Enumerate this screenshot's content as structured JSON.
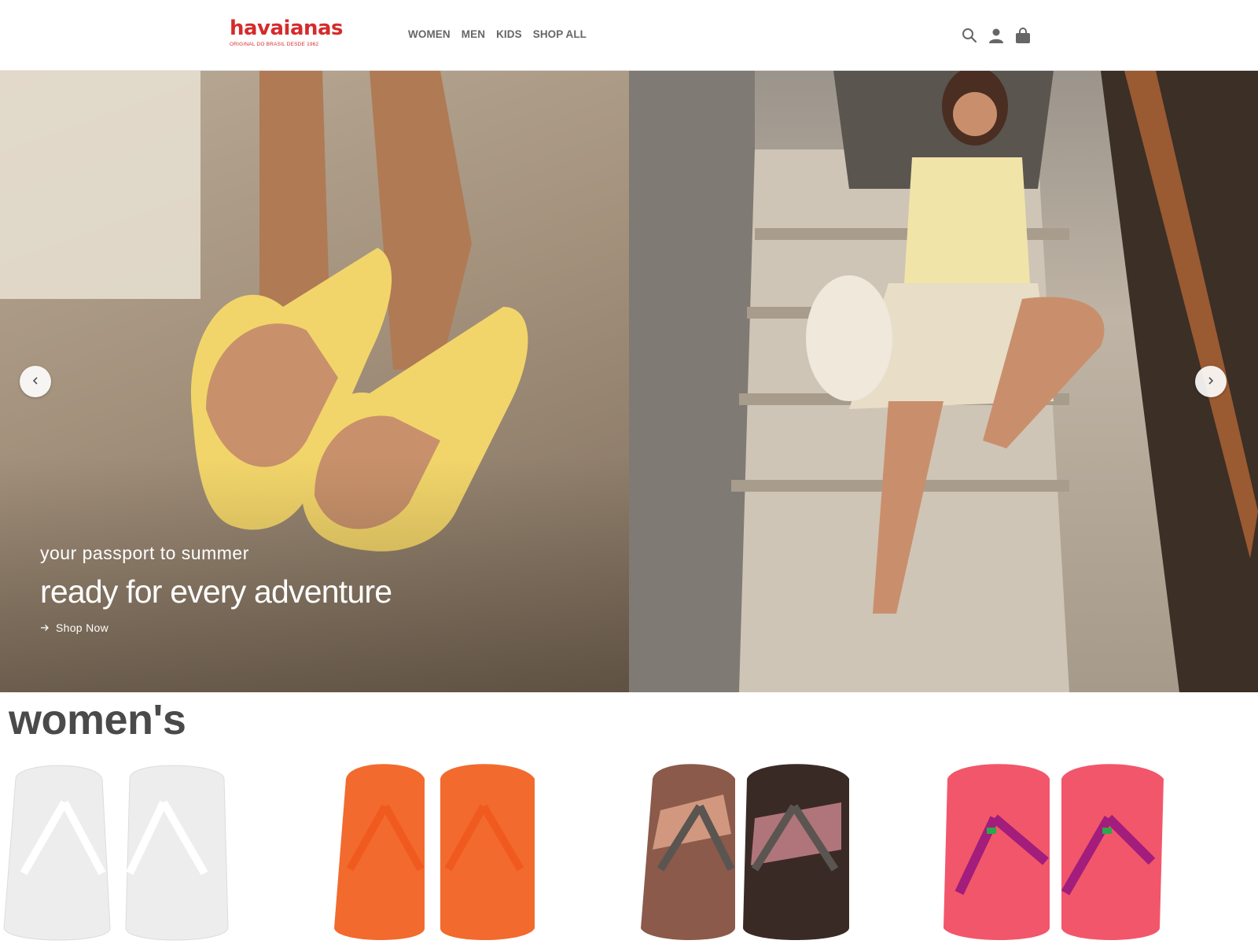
{
  "header": {
    "logo_word": "havaianas",
    "logo_tag": "ORIGINAL DO BRASIL DESDE 1962",
    "nav": [
      "WOMEN",
      "MEN",
      "KIDS",
      "SHOP ALL"
    ],
    "icons": [
      "search-icon",
      "account-icon",
      "bag-icon"
    ]
  },
  "hero": {
    "kicker": "your passport to summer",
    "headline": "ready for every adventure",
    "cta": "Shop Now",
    "prev_icon": "chevron-left-icon",
    "next_icon": "chevron-right-icon"
  },
  "section": {
    "title": "women's"
  },
  "products": [
    {
      "name": "white flip flop",
      "color": "#ededed",
      "strap": "#ffffff"
    },
    {
      "name": "orange flip flop",
      "color": "#f26a2e",
      "strap": "#f05a1f"
    },
    {
      "name": "camo print flip flop",
      "color": "#8b5a4a",
      "strap": "#5a5550"
    },
    {
      "name": "coral brazil flip flop",
      "color": "#f2566a",
      "strap": "#a21d7c"
    }
  ],
  "colors": {
    "brand": "#d52b2b",
    "nav_text": "#666666",
    "title_text": "#4a4a4a"
  }
}
